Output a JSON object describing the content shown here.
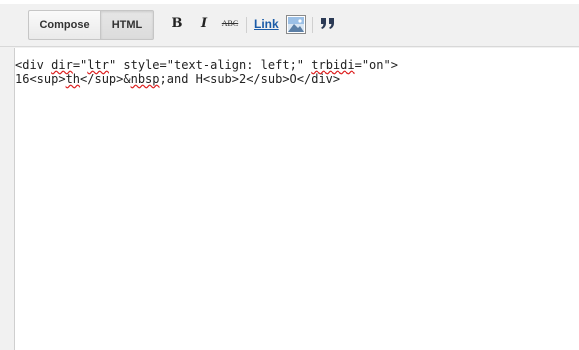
{
  "toolbar": {
    "compose_label": "Compose",
    "html_label": "HTML",
    "bold_label": "B",
    "italic_label": "I",
    "strike_label": "ABC",
    "link_label": "Link"
  },
  "icons": {
    "bold": "bold-icon",
    "italic": "italic-icon",
    "strikethrough": "strikethrough-icon",
    "image": "image-icon",
    "quote": "quote-icon"
  },
  "editor": {
    "line1": {
      "part1": "<div ",
      "dir": "dir",
      "part2": "=\"",
      "ltr": "ltr",
      "part3": "\" style=\"text-align: left;\" ",
      "trbidi": "trbidi",
      "part4": "=\"on\">"
    },
    "line2": {
      "part1": "16<sup>",
      "th": "th",
      "part2": "</sup>&",
      "nbsp": "nbsp",
      "part3": ";and H<sub>2</sub>O</div>"
    }
  },
  "colors": {
    "link": "#1a5ba8",
    "toolbar_bg": "#f1f1f1",
    "spellcheck_underline": "#dd2222"
  }
}
